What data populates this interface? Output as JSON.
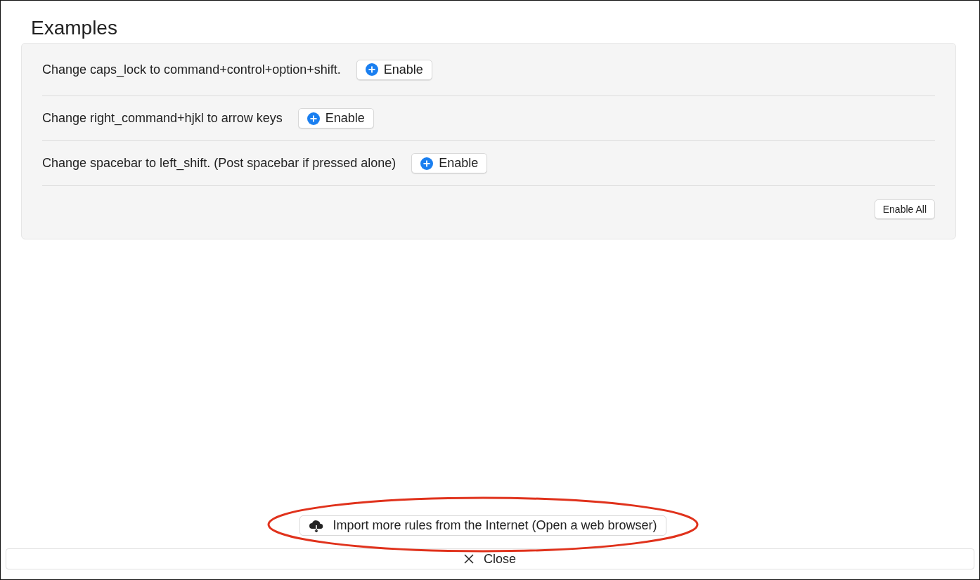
{
  "section": {
    "title": "Examples"
  },
  "rules": [
    {
      "description": "Change caps_lock to command+control+option+shift.",
      "button": "Enable"
    },
    {
      "description": "Change right_command+hjkl to arrow keys",
      "button": "Enable"
    },
    {
      "description": "Change spacebar to left_shift. (Post spacebar if pressed alone)",
      "button": "Enable"
    }
  ],
  "enable_all_button": "Enable All",
  "import_button": "Import more rules from the Internet (Open a web browser)",
  "close_button": "Close"
}
